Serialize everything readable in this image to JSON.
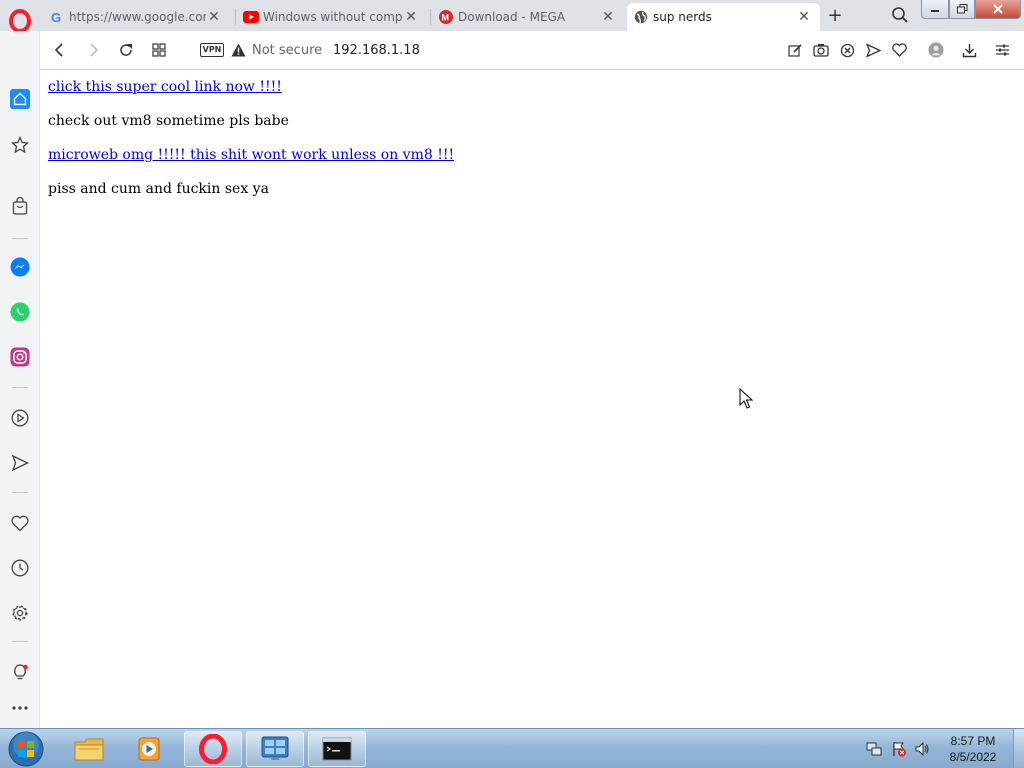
{
  "browser": {
    "tabs": [
      {
        "title": "https://www.google.com/s",
        "favicon": "google-favicon-icon",
        "active": false
      },
      {
        "title": "Windows without compon",
        "favicon": "youtube-favicon-icon",
        "active": false
      },
      {
        "title": "Download - MEGA",
        "favicon": "mega-favicon-icon",
        "active": false
      },
      {
        "title": "sup nerds",
        "favicon": "globe-favicon-icon",
        "active": true
      }
    ],
    "close_glyph": "✕",
    "new_tab_glyph": "+"
  },
  "addressbar": {
    "vpn_label": "VPN",
    "security_label": "Not secure",
    "url": "192.168.1.18"
  },
  "page": {
    "link1": "click this super cool link now !!!!",
    "text1": "check out vm8 sometime pls babe",
    "link2": "microweb omg !!!!! this shit wont work unless on vm8 !!!",
    "text2": "piss and cum and fuckin sex ya"
  },
  "taskbar": {
    "time": "8:57 PM",
    "date": "8/5/2022"
  },
  "colors": {
    "opera_red": "#ff1b2d",
    "link_blue": "#0000ee",
    "sidebar_active": "#1a8cff",
    "messenger": "#0a7cff",
    "whatsapp": "#25d366",
    "instagram": "#c13584"
  }
}
